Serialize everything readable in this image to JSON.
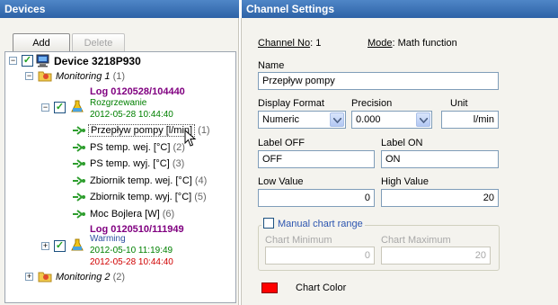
{
  "panels": {
    "devices_title": "Devices",
    "channel_settings_title": "Channel Settings"
  },
  "toolbar": {
    "add_label": "Add",
    "delete_label": "Delete"
  },
  "tree": {
    "device": "Device 3218P930",
    "monitoring1": "Monitoring 1",
    "monitoring1_count": "(1)",
    "log1": "Log 0120528/104440",
    "rozgrzewanie": {
      "name": "Rozgrzewanie",
      "date": "2012-05-28 10:44:40"
    },
    "channels": [
      {
        "label": "Przepływ pompy [l/min]",
        "count": "(1)"
      },
      {
        "label": "PS temp. wej. [°C]",
        "count": "(2)"
      },
      {
        "label": "PS temp. wyj. [°C]",
        "count": "(3)"
      },
      {
        "label": "Zbiornik temp. wej. [°C]",
        "count": "(4)"
      },
      {
        "label": "Zbiornik temp. wyj. [°C]",
        "count": "(5)"
      },
      {
        "label": "Moc Bojlera [W]",
        "count": "(6)"
      }
    ],
    "log2": "Log 0120510/111949",
    "warming": {
      "name": "Warming",
      "start": "2012-05-10 11:19:49",
      "end": "2012-05-28 10:44:40"
    },
    "monitoring2": "Monitoring 2",
    "monitoring2_count": "(2)"
  },
  "settings": {
    "channel_no_label": "Channel No",
    "channel_no_value": ": 1",
    "mode_label": "Mode",
    "mode_value": ": Math function",
    "name_label": "Name",
    "name_value": "Przepływ pompy",
    "display_format_label": "Display Format",
    "display_format_value": "Numeric",
    "precision_label": "Precision",
    "precision_value": "0.000",
    "unit_label": "Unit",
    "unit_value": "l/min",
    "label_off_label": "Label OFF",
    "label_off_value": "OFF",
    "label_on_label": "Label ON",
    "label_on_value": "ON",
    "low_value_label": "Low Value",
    "low_value": "0",
    "high_value_label": "High Value",
    "high_value": "20",
    "manual_range_label": "Manual chart range",
    "chart_min_label": "Chart Minimum",
    "chart_min_value": "0",
    "chart_max_label": "Chart Maximum",
    "chart_max_value": "20",
    "chart_color_label": "Chart Color",
    "chart_color": "#ff0000"
  },
  "icons": {
    "device": "computer-icon",
    "monitoring": "monitoring-folder-icon",
    "test": "flask-icon",
    "channel": "channel-arrow-icon",
    "cursor": "mouse-pointer-icon"
  },
  "colors": {
    "header_bg": "#3a72b8",
    "log": "#800080",
    "date_start": "#008000",
    "date_end": "#d00000",
    "check": "#21a121"
  }
}
